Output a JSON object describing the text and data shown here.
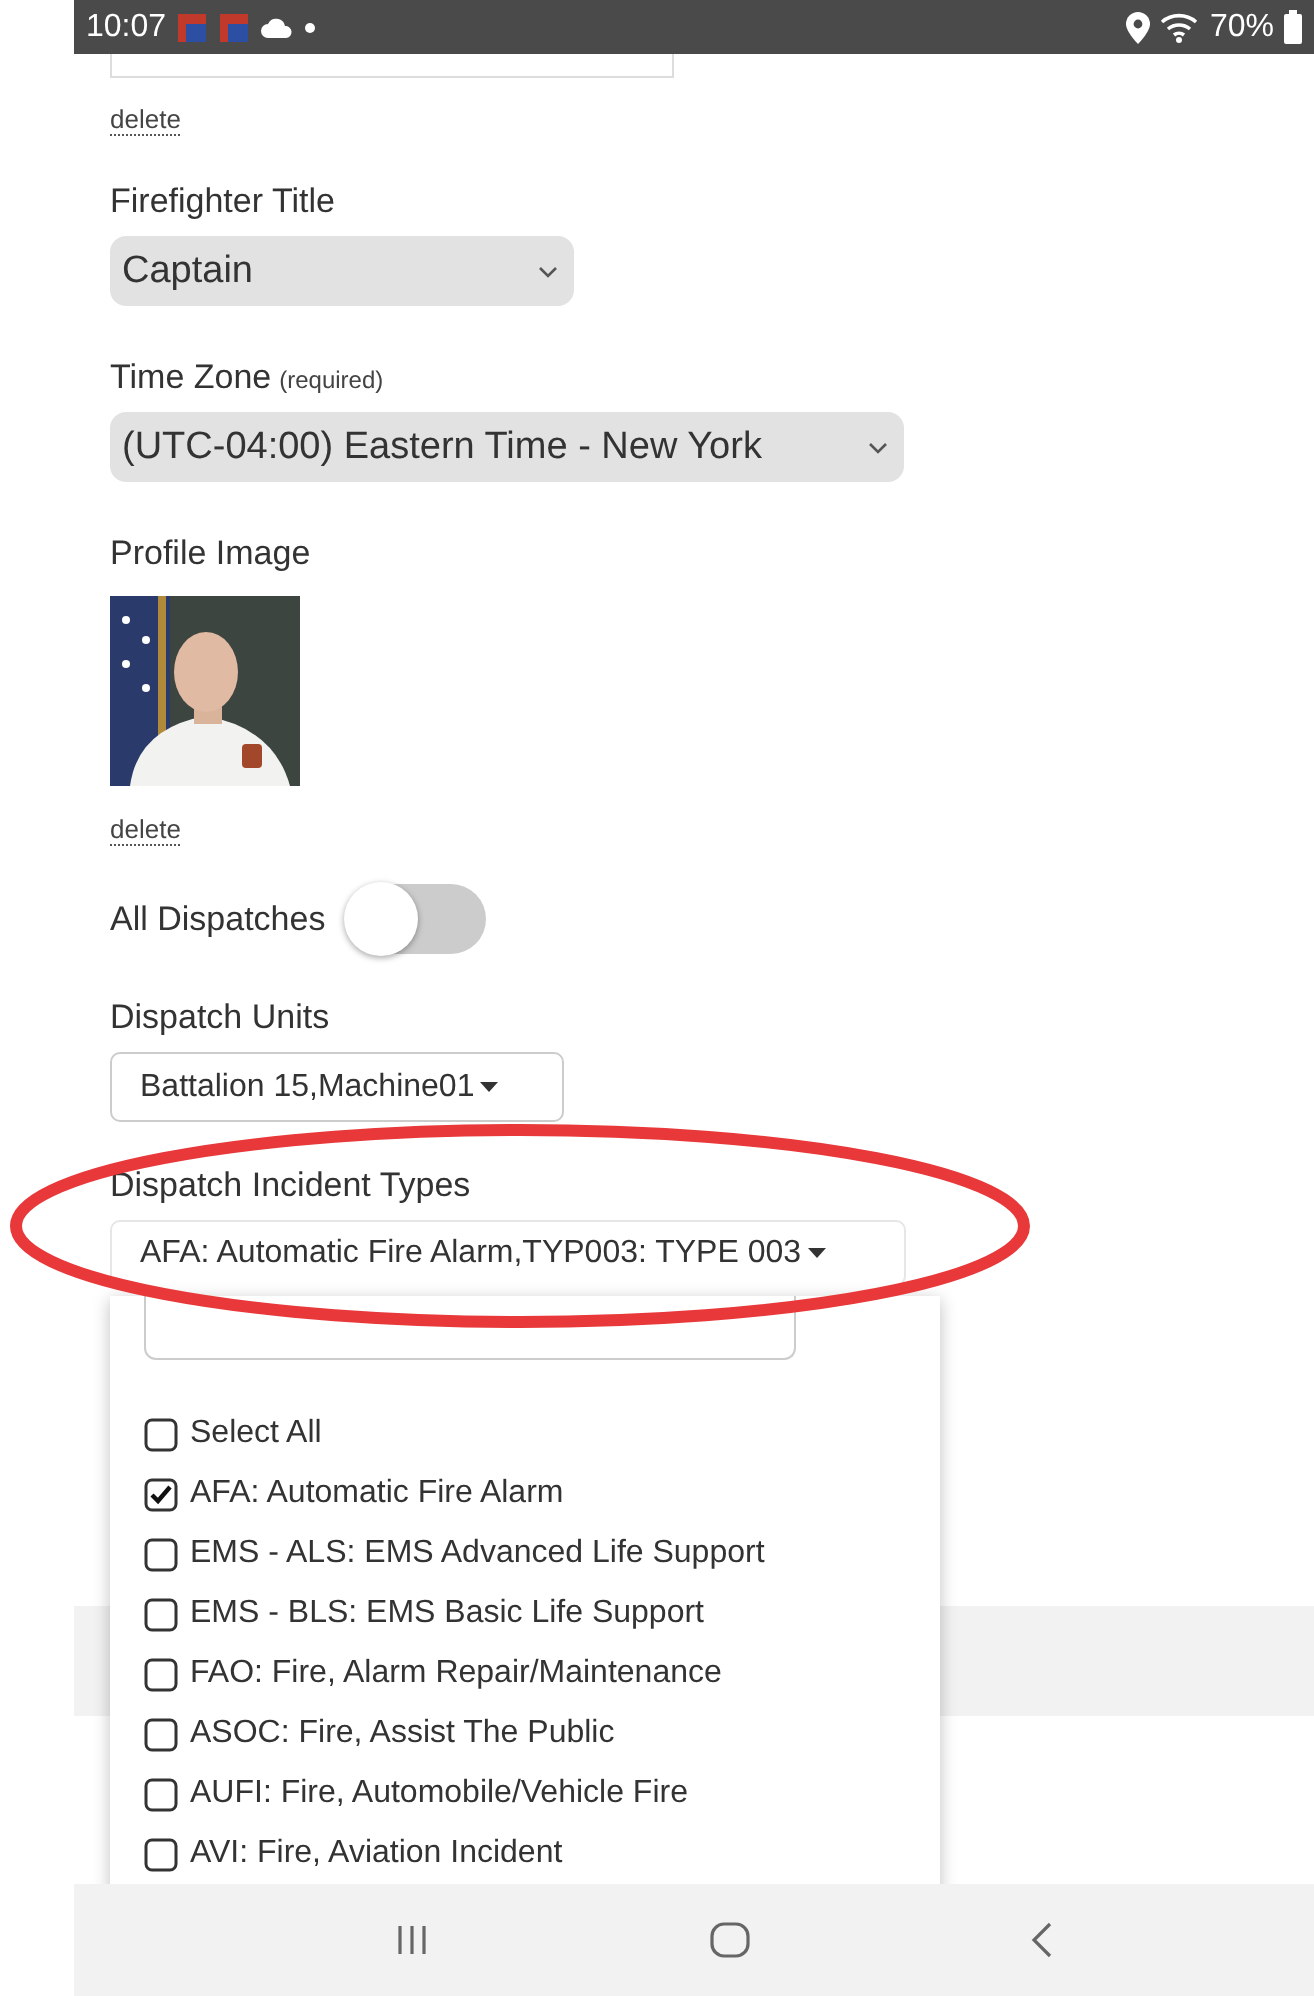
{
  "status_bar": {
    "time": "10:07",
    "battery": "70%"
  },
  "form": {
    "top_delete": "delete",
    "firefighter_title": {
      "label": "Firefighter Title",
      "value": "Captain"
    },
    "time_zone": {
      "label": "Time Zone",
      "hint": "(required)",
      "value": "(UTC-04:00) Eastern Time - New York"
    },
    "profile_image": {
      "label": "Profile Image",
      "delete": "delete"
    },
    "all_dispatches": {
      "label": "All Dispatches",
      "on": false
    },
    "dispatch_units": {
      "label": "Dispatch Units",
      "value": "Battalion 15,Machine01"
    },
    "incident_types": {
      "label": "Dispatch Incident Types",
      "value": "AFA: Automatic Fire Alarm,TYP003: TYPE 003",
      "expanded": true,
      "options": [
        {
          "label": "Select All",
          "checked": false
        },
        {
          "label": "AFA: Automatic Fire Alarm",
          "checked": true
        },
        {
          "label": "EMS - ALS: EMS Advanced Life Support",
          "checked": false
        },
        {
          "label": "EMS - BLS: EMS Basic Life Support",
          "checked": false
        },
        {
          "label": "FAO: Fire, Alarm Repair/Maintenance",
          "checked": false
        },
        {
          "label": "ASOC: Fire, Assist The Public",
          "checked": false
        },
        {
          "label": "AUFI: Fire, Automobile/Vehicle Fire",
          "checked": false
        },
        {
          "label": "AVI: Fire, Aviation Incident",
          "checked": false
        }
      ]
    }
  }
}
